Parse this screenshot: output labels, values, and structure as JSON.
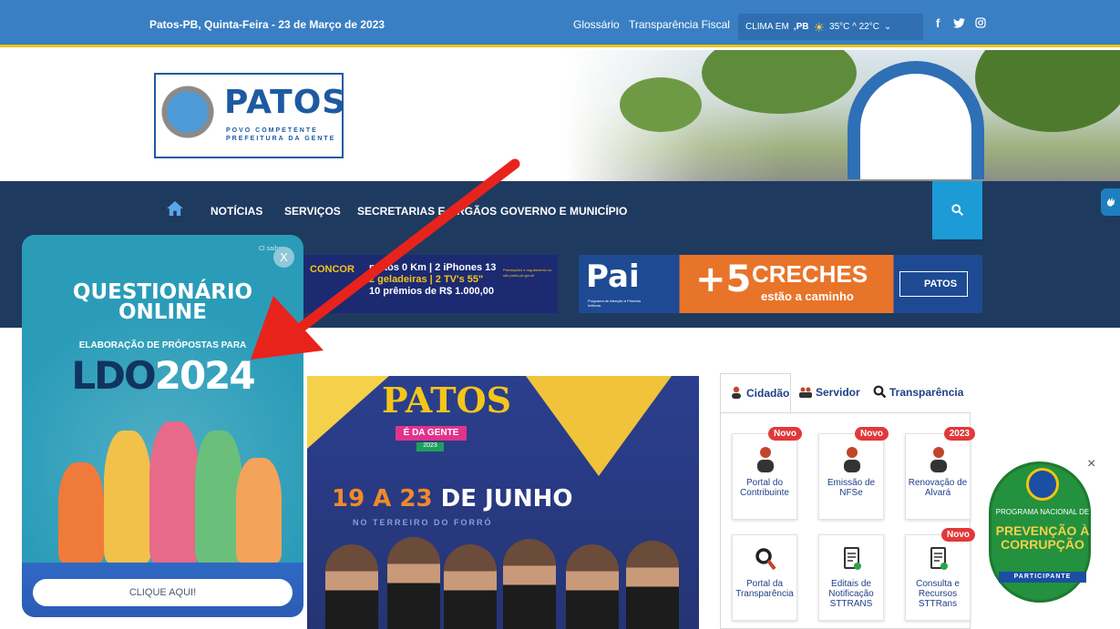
{
  "topbar": {
    "date": "Patos-PB, Quinta-Feira - 23 de Março de 2023",
    "glossary_link": "Glossário",
    "transparency_link": "Transparência Fiscal",
    "weather": {
      "prefix": "CLIMA EM",
      "city": ",PB",
      "temps": "35°C ^ 22°C",
      "dropdown": "⌄"
    },
    "social": {
      "facebook": "f",
      "twitter": "🐦",
      "instagram": "◎"
    }
  },
  "header": {
    "logo_title": "PATOS",
    "logo_sub1": "POVO COMPETENTE",
    "logo_sub2": "PREFEITURA DA GENTE"
  },
  "nav": {
    "items": [
      "NOTÍCIAS",
      "SERVIÇOS",
      "SECRETARIAS E ÓRGÃOS",
      "GOVERNO E MUNICÍPIO"
    ]
  },
  "banners": {
    "ad1": {
      "lead": "CONCOR",
      "line1": "motos 0 Km | 2 iPhones 13",
      "line2": "2 geladeiras | 2 TV's 55\"",
      "line3": "10 prêmios de R$ 1.000,00",
      "note": "Premiações e regulamento no site patos.pb.gov.br"
    },
    "ad2": {
      "pai": "Pai",
      "pai_sub": "Programa de Atenção à Primeira Infância",
      "plus": "+5",
      "creches": "CRECHES",
      "caminho": "estão a caminho",
      "patos": "PATOS"
    }
  },
  "poster": {
    "title": "PATOS",
    "tag": "É DA GENTE",
    "year": "2023",
    "dates_a": "19 A 23",
    "dates_b": " DE JUNHO",
    "subtitle": "NO TERREIRO DO FORRÓ"
  },
  "tabs": {
    "items": [
      "Cidadão",
      "Servidor",
      "Transparência"
    ],
    "cards": [
      {
        "label": "Portal do Contribuinte",
        "badge": "Novo"
      },
      {
        "label": "Emissão de NFSe",
        "badge": "Novo"
      },
      {
        "label": "Renovação de Alvará",
        "badge": "2023"
      },
      {
        "label": "Portal da Transparência",
        "badge": ""
      },
      {
        "label": "Editais de Notificação STTRANS",
        "badge": ""
      },
      {
        "label": "Consulta e Recursos STTRans",
        "badge": "Novo"
      }
    ]
  },
  "popup": {
    "title_line1": "QUESTIONÁRIO",
    "title_line2": "ONLINE",
    "subtitle": "ELABORAÇÃO DE PRÓPOSTAS PARA",
    "ldo": "LDO",
    "year": "2024",
    "close": "X",
    "saiba": "Cl saibar",
    "cta": "CLIQUE AQUI!"
  },
  "pnpc": {
    "close": "×",
    "programa": "PROGRAMA NACIONAL DE",
    "prevencao": "PREVENÇÃO À CORRUPÇÃO",
    "participante": "PARTICIPANTE"
  },
  "colors": {
    "topbar": "#3a7fc3",
    "nav": "#1f3a5f",
    "search": "#1c9bd6",
    "badge": "#e2383a",
    "arrow": "#e8231c"
  }
}
